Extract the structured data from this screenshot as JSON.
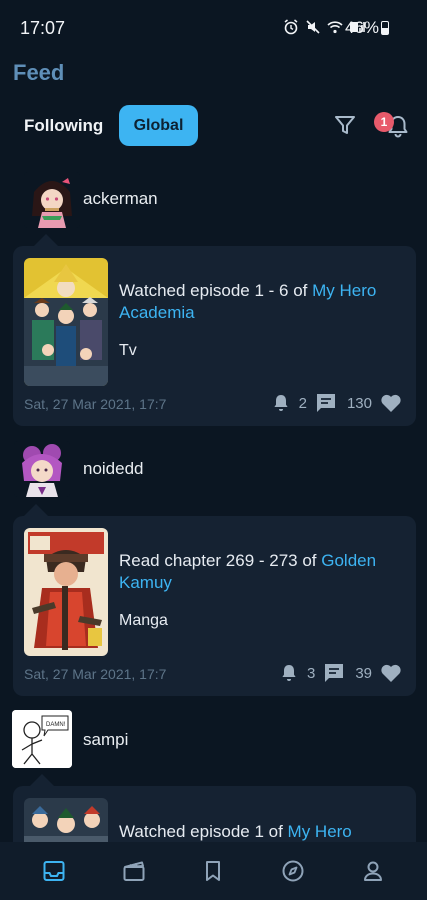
{
  "status_bar": {
    "time": "17:07",
    "battery": "46%"
  },
  "header": {
    "title": "Feed"
  },
  "tabs": {
    "following": "Following",
    "global": "Global"
  },
  "notifications": {
    "badge": "1"
  },
  "accent_color": "#3db4f2",
  "feed": [
    {
      "user": "ackerman",
      "action": "Watched episode 1 - 6 of ",
      "media_title": "My Hero Academia",
      "media_type": "Tv",
      "date": "Sat, 27 Mar 2021, 17:7",
      "replies": "2",
      "likes": "130"
    },
    {
      "user": "noidedd",
      "action": "Read chapter 269 - 273 of ",
      "media_title": "Golden Kamuy",
      "media_type": "Manga",
      "date": "Sat, 27 Mar 2021, 17:7",
      "replies": "3",
      "likes": "39"
    },
    {
      "user": "sampi",
      "action": "Watched episode 1 of ",
      "media_title": "My Hero",
      "avatar_text": "DAMN!"
    }
  ],
  "nav": [
    "inbox-icon",
    "film-icon",
    "bookmark-icon",
    "compass-icon",
    "profile-icon"
  ]
}
